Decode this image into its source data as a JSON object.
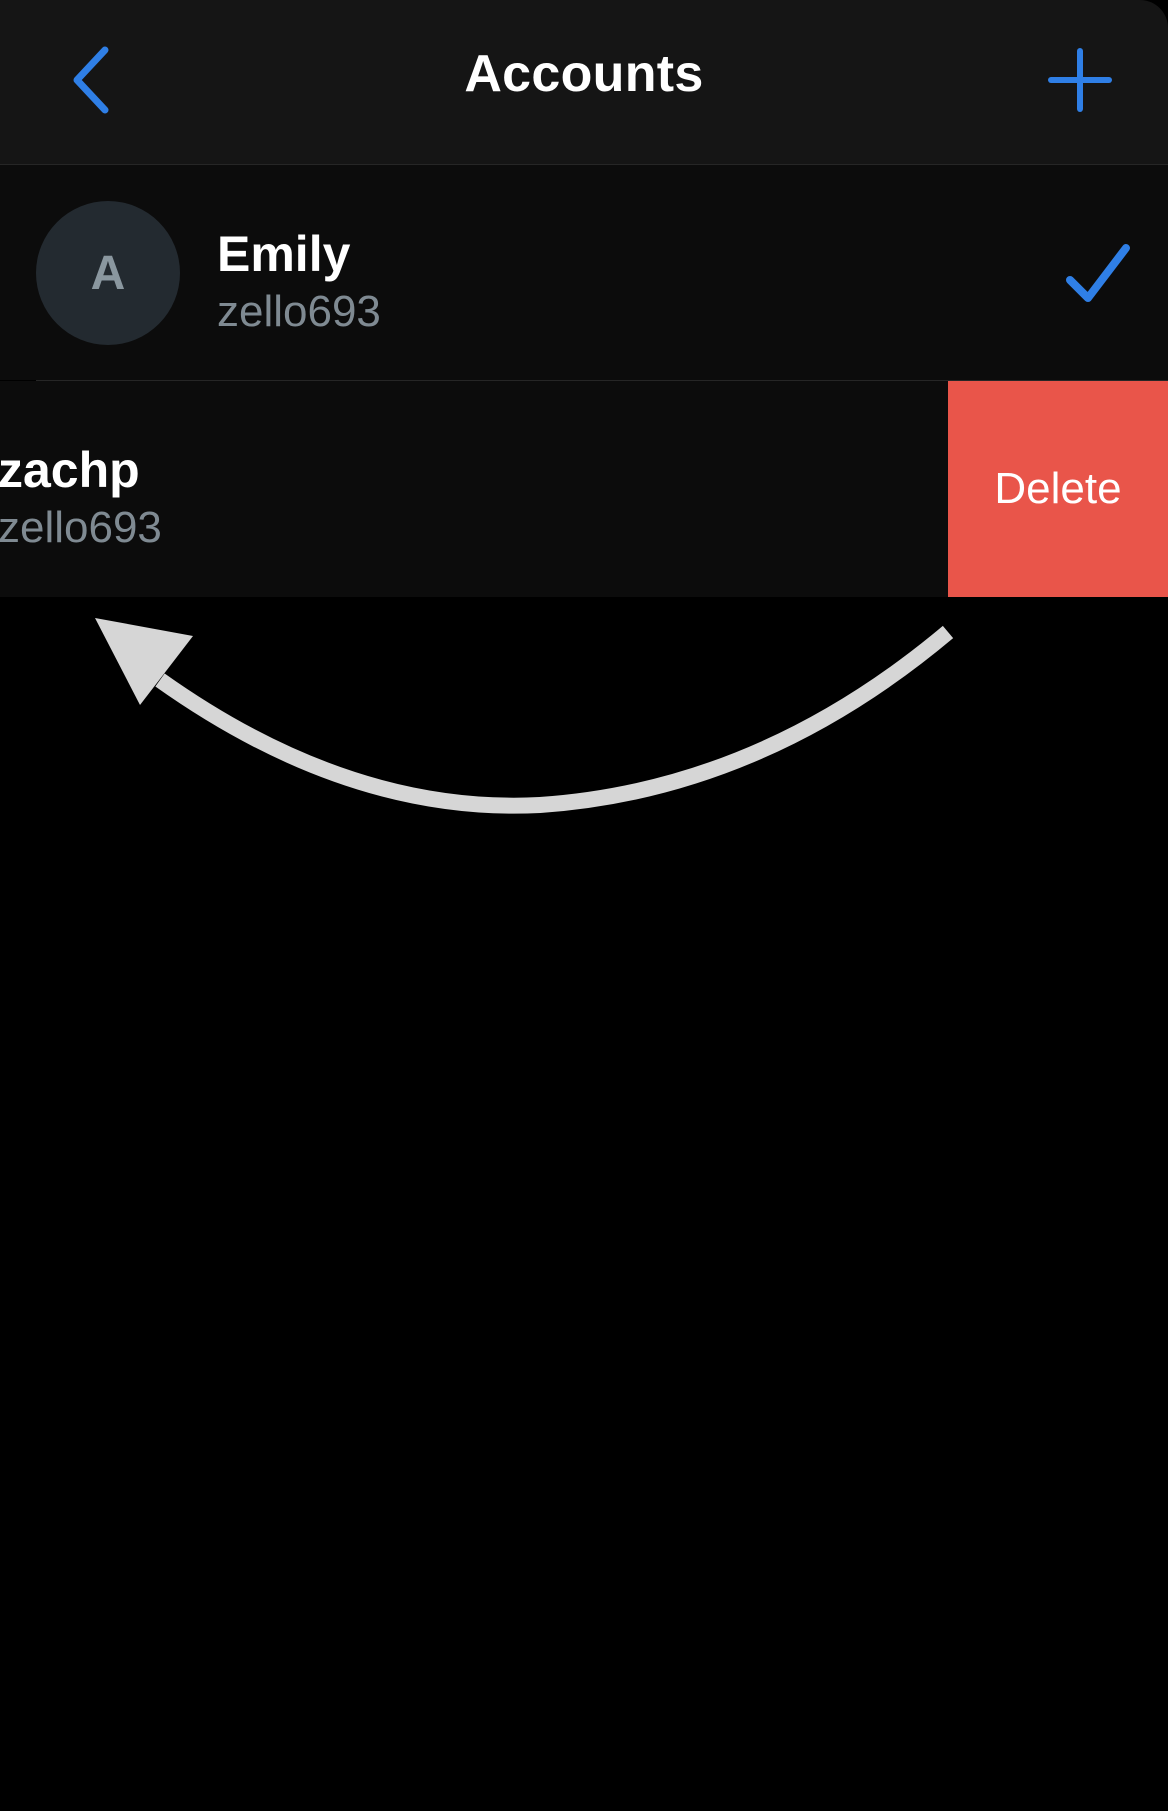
{
  "header": {
    "title": "Accounts",
    "back_icon": "chevron-left-icon",
    "add_icon": "plus-icon"
  },
  "accounts": [
    {
      "avatar_letter": "A",
      "name": "Emily",
      "username": "zello693",
      "selected": true
    },
    {
      "name": "zachp",
      "username": "zello693",
      "selected": false
    }
  ],
  "swipe_action": {
    "label": "Delete"
  },
  "gesture_hint": {
    "icon": "swipe-left-arrow-icon"
  },
  "colors": {
    "accent": "#2f7fe6",
    "delete": "#e9554a",
    "background": "#000000",
    "navbar": "#151515",
    "row": "#0c0c0c"
  }
}
